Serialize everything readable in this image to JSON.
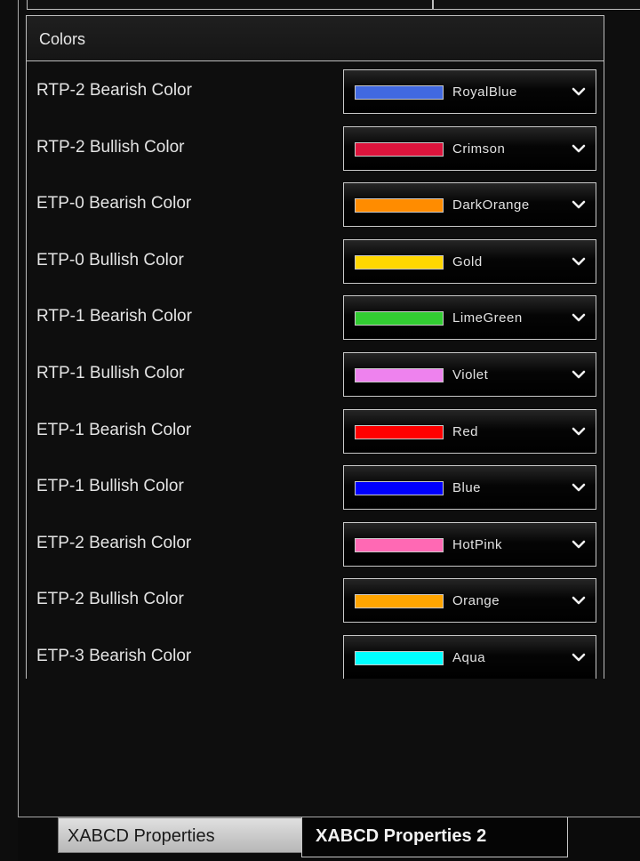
{
  "section": {
    "title": "Colors"
  },
  "rows": [
    {
      "label": "RTP-2 Bearish Color",
      "color_name": "RoyalBlue",
      "swatch": "#4169E1"
    },
    {
      "label": "RTP-2 Bullish Color",
      "color_name": "Crimson",
      "swatch": "#DC143C"
    },
    {
      "label": "ETP-0 Bearish Color",
      "color_name": "DarkOrange",
      "swatch": "#FF8C00"
    },
    {
      "label": "ETP-0 Bullish Color",
      "color_name": "Gold",
      "swatch": "#FFD700"
    },
    {
      "label": "RTP-1 Bearish Color",
      "color_name": "LimeGreen",
      "swatch": "#32CD32"
    },
    {
      "label": "RTP-1 Bullish Color",
      "color_name": "Violet",
      "swatch": "#EE82EE"
    },
    {
      "label": "ETP-1 Bearish Color",
      "color_name": "Red",
      "swatch": "#FF0000"
    },
    {
      "label": "ETP-1 Bullish Color",
      "color_name": "Blue",
      "swatch": "#0000FF"
    },
    {
      "label": "ETP-2 Bearish Color",
      "color_name": "HotPink",
      "swatch": "#FF69B4"
    },
    {
      "label": "ETP-2 Bullish Color",
      "color_name": "Orange",
      "swatch": "#FFA500"
    },
    {
      "label": "ETP-3 Bearish Color",
      "color_name": "Aqua",
      "swatch": "#00FFFF"
    }
  ],
  "dropdown_icon": "chevron-down-icon",
  "tabs": [
    {
      "label": "XABCD Properties",
      "active": false
    },
    {
      "label": "XABCD Properties 2",
      "active": true
    }
  ]
}
